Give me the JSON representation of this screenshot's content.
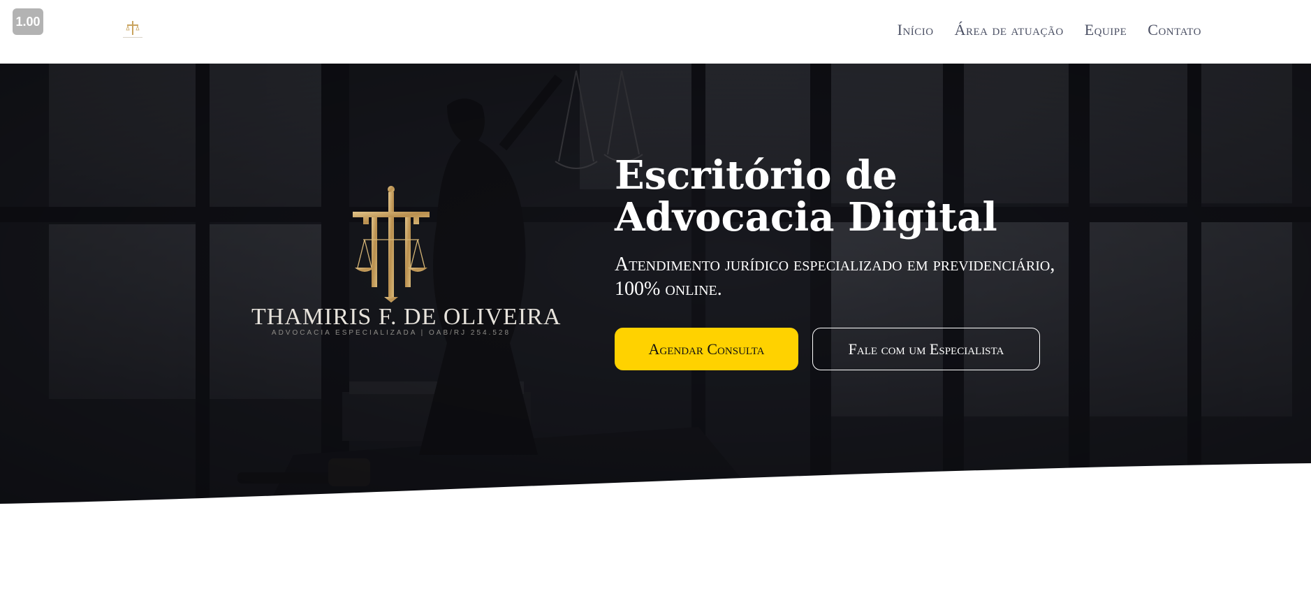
{
  "zoom": {
    "label": "1.00"
  },
  "header": {
    "logo_alt": "Thamiris F. de Oliveira logo",
    "nav": [
      {
        "label": "Início"
      },
      {
        "label": "Área de atuação"
      },
      {
        "label": "Equipe"
      },
      {
        "label": "Contato"
      }
    ]
  },
  "hero": {
    "brand": {
      "name": "THAMIRIS F. DE OLIVEIRA",
      "tagline": "ADVOCACIA ESPECIALIZADA | OAB/RJ 254.528"
    },
    "title_line1": "Escritório de",
    "title_line2": "Advocacia Digital",
    "subtitle": "Atendimento jurídico especializado em previdenciário, 100% online.",
    "buttons": {
      "primary": "Agendar Consulta",
      "secondary": "Fale com um Especialista"
    }
  },
  "colors": {
    "accent": "#ffd200",
    "nav_text": "#4a4f63",
    "gold": "#c9a35e",
    "hero_dark": "#2b2c30"
  }
}
